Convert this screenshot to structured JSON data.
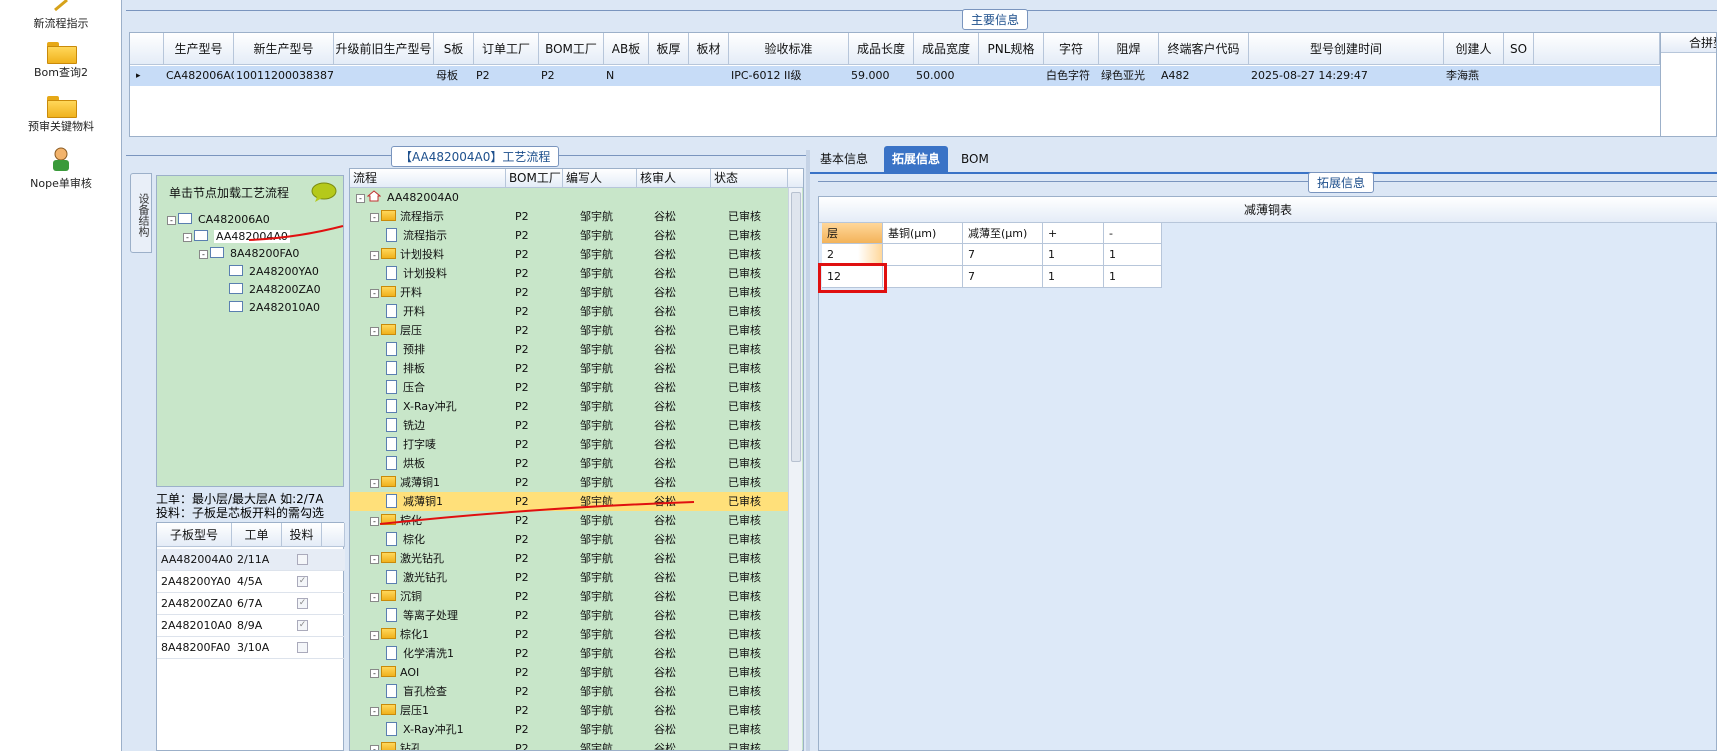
{
  "sidebar": {
    "items": [
      {
        "label": "新流程指示",
        "icon": "pencil-icon"
      },
      {
        "label": "Bom查询2",
        "icon": "folder-icon"
      },
      {
        "label": "预审关键物料",
        "icon": "folder-icon"
      },
      {
        "label": "Nope单审核",
        "icon": "user-icon"
      }
    ]
  },
  "main_info": {
    "title": "主要信息",
    "columns": [
      "生产型号",
      "新生产型号",
      "升级前旧生产型号",
      "S板",
      "订单工厂",
      "BOM工厂",
      "AB板",
      "板厚",
      "板材",
      "验收标准",
      "成品长度",
      "成品宽度",
      "PNL规格",
      "字符",
      "阻焊",
      "终端客户代码",
      "型号创建时间",
      "创建人",
      "SO"
    ],
    "right_column": "合拼型",
    "row": {
      "生产型号": "CA482006A0",
      "新生产型号": "10011200038387",
      "升级前旧生产型号": "",
      "S板": "母板",
      "订单工厂": "P2",
      "BOM工厂": "P2",
      "AB板": "N",
      "板厚": "",
      "板材": "",
      "验收标准": "IPC-6012 II级",
      "成品长度": "59.000",
      "成品宽度": "50.000",
      "PNL规格": "",
      "字符": "白色字符",
      "阻焊": "绿色亚光",
      "终端客户代码": "A482",
      "型号创建时间": "2025-08-27 14:29:47",
      "创建人": "李海燕",
      "SO": ""
    }
  },
  "process": {
    "title": "【AA482004A0】工艺流程",
    "vertical_tab": "设备结构",
    "hint": "单击节点加载工艺流程",
    "tree": [
      "CA482006A0",
      "AA482004A0",
      "8A48200FA0",
      "2A48200YA0",
      "2A48200ZA0",
      "2A482010A0"
    ],
    "info_line1": "工单：最小层/最大层A 如:2/7A",
    "info_line2": "投料：子板是芯板开料的需勾选",
    "sub_headers": [
      "子板型号",
      "工单",
      "投料"
    ],
    "sub_rows": [
      {
        "model": "AA482004A0",
        "order": "2/11A",
        "checked": false
      },
      {
        "model": "2A48200YA0",
        "order": "4/5A",
        "checked": true
      },
      {
        "model": "2A48200ZA0",
        "order": "6/7A",
        "checked": true
      },
      {
        "model": "2A482010A0",
        "order": "8/9A",
        "checked": true
      },
      {
        "model": "8A48200FA0",
        "order": "3/10A",
        "checked": false
      }
    ]
  },
  "flow": {
    "headers": [
      "流程",
      "BOM工厂",
      "编写人",
      "核审人",
      "状态"
    ],
    "rows": [
      {
        "name": "AA482004A0",
        "kind": "root",
        "factory": "",
        "writer": "",
        "reviewer": "",
        "status": ""
      },
      {
        "name": "流程指示",
        "kind": "group",
        "factory": "P2",
        "writer": "邹宇航",
        "reviewer": "谷松",
        "status": "已审核"
      },
      {
        "name": "流程指示",
        "kind": "item",
        "factory": "P2",
        "writer": "邹宇航",
        "reviewer": "谷松",
        "status": "已审核"
      },
      {
        "name": "计划投料",
        "kind": "group",
        "factory": "P2",
        "writer": "邹宇航",
        "reviewer": "谷松",
        "status": "已审核"
      },
      {
        "name": "计划投料",
        "kind": "item",
        "factory": "P2",
        "writer": "邹宇航",
        "reviewer": "谷松",
        "status": "已审核"
      },
      {
        "name": "开料",
        "kind": "group",
        "factory": "P2",
        "writer": "邹宇航",
        "reviewer": "谷松",
        "status": "已审核"
      },
      {
        "name": "开料",
        "kind": "item",
        "factory": "P2",
        "writer": "邹宇航",
        "reviewer": "谷松",
        "status": "已审核"
      },
      {
        "name": "层压",
        "kind": "group",
        "factory": "P2",
        "writer": "邹宇航",
        "reviewer": "谷松",
        "status": "已审核"
      },
      {
        "name": "预排",
        "kind": "item",
        "factory": "P2",
        "writer": "邹宇航",
        "reviewer": "谷松",
        "status": "已审核"
      },
      {
        "name": "排板",
        "kind": "item",
        "factory": "P2",
        "writer": "邹宇航",
        "reviewer": "谷松",
        "status": "已审核"
      },
      {
        "name": "压合",
        "kind": "item",
        "factory": "P2",
        "writer": "邹宇航",
        "reviewer": "谷松",
        "status": "已审核"
      },
      {
        "name": "X-Ray冲孔",
        "kind": "item",
        "factory": "P2",
        "writer": "邹宇航",
        "reviewer": "谷松",
        "status": "已审核"
      },
      {
        "name": "铣边",
        "kind": "item",
        "factory": "P2",
        "writer": "邹宇航",
        "reviewer": "谷松",
        "status": "已审核"
      },
      {
        "name": "打字唛",
        "kind": "item",
        "factory": "P2",
        "writer": "邹宇航",
        "reviewer": "谷松",
        "status": "已审核"
      },
      {
        "name": "烘板",
        "kind": "item",
        "factory": "P2",
        "writer": "邹宇航",
        "reviewer": "谷松",
        "status": "已审核"
      },
      {
        "name": "减薄铜1",
        "kind": "group",
        "factory": "P2",
        "writer": "邹宇航",
        "reviewer": "谷松",
        "status": "已审核"
      },
      {
        "name": "减薄铜1",
        "kind": "item",
        "factory": "P2",
        "writer": "邹宇航",
        "reviewer": "谷松",
        "status": "已审核",
        "selected": true
      },
      {
        "name": "棕化",
        "kind": "group",
        "factory": "P2",
        "writer": "邹宇航",
        "reviewer": "谷松",
        "status": "已审核"
      },
      {
        "name": "棕化",
        "kind": "item",
        "factory": "P2",
        "writer": "邹宇航",
        "reviewer": "谷松",
        "status": "已审核"
      },
      {
        "name": "激光钻孔",
        "kind": "group",
        "factory": "P2",
        "writer": "邹宇航",
        "reviewer": "谷松",
        "status": "已审核"
      },
      {
        "name": "激光钻孔",
        "kind": "item",
        "factory": "P2",
        "writer": "邹宇航",
        "reviewer": "谷松",
        "status": "已审核"
      },
      {
        "name": "沉铜",
        "kind": "group",
        "factory": "P2",
        "writer": "邹宇航",
        "reviewer": "谷松",
        "status": "已审核"
      },
      {
        "name": "等离子处理",
        "kind": "item",
        "factory": "P2",
        "writer": "邹宇航",
        "reviewer": "谷松",
        "status": "已审核"
      },
      {
        "name": "棕化1",
        "kind": "group",
        "factory": "P2",
        "writer": "邹宇航",
        "reviewer": "谷松",
        "status": "已审核"
      },
      {
        "name": "化学清洗1",
        "kind": "item",
        "factory": "P2",
        "writer": "邹宇航",
        "reviewer": "谷松",
        "status": "已审核"
      },
      {
        "name": "AOI",
        "kind": "group",
        "factory": "P2",
        "writer": "邹宇航",
        "reviewer": "谷松",
        "status": "已审核"
      },
      {
        "name": "盲孔检查",
        "kind": "item",
        "factory": "P2",
        "writer": "邹宇航",
        "reviewer": "谷松",
        "status": "已审核"
      },
      {
        "name": "层压1",
        "kind": "group",
        "factory": "P2",
        "writer": "邹宇航",
        "reviewer": "谷松",
        "status": "已审核"
      },
      {
        "name": "X-Ray冲孔1",
        "kind": "item",
        "factory": "P2",
        "writer": "邹宇航",
        "reviewer": "谷松",
        "status": "已审核"
      },
      {
        "name": "钻孔",
        "kind": "group",
        "factory": "P2",
        "writer": "邹宇航",
        "reviewer": "谷松",
        "status": "已审核"
      }
    ]
  },
  "tabs": [
    "基本信息",
    "拓展信息",
    "BOM"
  ],
  "ext": {
    "title": "拓展信息",
    "table_title": "减薄铜表",
    "headers": [
      "层",
      "基铜(μm)",
      "减薄至(μm)",
      "+",
      "-"
    ],
    "rows": [
      [
        "2",
        "",
        "7",
        "1",
        "1"
      ],
      [
        "12",
        "",
        "7",
        "1",
        "1"
      ]
    ]
  },
  "colors": {
    "selection": "#ffe07a",
    "tree_bg": "#c8e6c9",
    "accent": "#3a73c6",
    "highlight": "#e01010"
  }
}
